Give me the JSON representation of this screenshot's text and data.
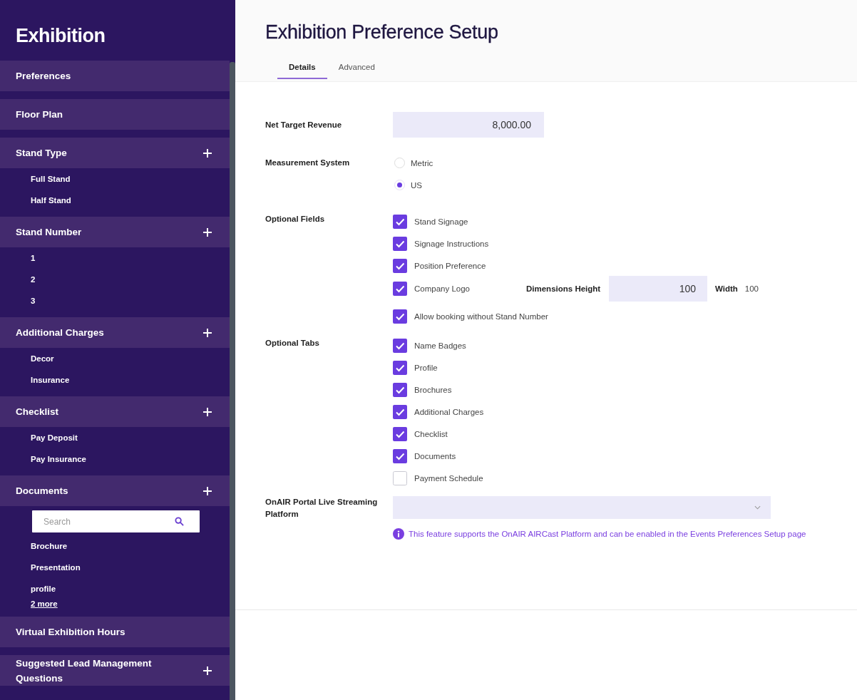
{
  "sidebar": {
    "title": "Exhibition",
    "sections": [
      {
        "label": "Preferences",
        "expandable": false
      },
      {
        "label": "Floor Plan",
        "expandable": false
      },
      {
        "label": "Stand Type",
        "expandable": true,
        "items": [
          {
            "label": "Full Stand"
          },
          {
            "label": "Half Stand"
          }
        ]
      },
      {
        "label": "Stand Number",
        "expandable": true,
        "items": [
          {
            "label": "1"
          },
          {
            "label": "2"
          },
          {
            "label": "3"
          }
        ]
      },
      {
        "label": "Additional Charges",
        "expandable": true,
        "items": [
          {
            "label": "Decor"
          },
          {
            "label": "Insurance"
          }
        ]
      },
      {
        "label": "Checklist",
        "expandable": true,
        "items": [
          {
            "label": "Pay Deposit"
          },
          {
            "label": "Pay Insurance"
          }
        ]
      },
      {
        "label": "Documents",
        "expandable": true,
        "search": {
          "placeholder": "Search"
        },
        "items": [
          {
            "label": "Brochure"
          },
          {
            "label": "Presentation"
          },
          {
            "label": "profile"
          }
        ],
        "more_link": "2 more"
      },
      {
        "label": "Virtual Exhibition Hours",
        "expandable": false
      },
      {
        "label": "Suggested Lead Management Questions",
        "expandable": true
      }
    ]
  },
  "page": {
    "title": "Exhibition Preference Setup",
    "tabs": [
      {
        "label": "Details",
        "selected": true
      },
      {
        "label": "Advanced",
        "selected": false
      }
    ]
  },
  "form": [
    {
      "kind": "text",
      "label": "Net Target Revenue",
      "value": "8,000.00"
    },
    {
      "kind": "radio",
      "label": "Measurement System",
      "options": [
        {
          "label": "Metric",
          "selected": false
        },
        {
          "label": "US",
          "selected": true
        }
      ]
    },
    {
      "kind": "checkbox",
      "label": "Optional Fields",
      "options": [
        {
          "label": "Stand Signage",
          "checked": true
        },
        {
          "label": "Signage Instructions",
          "checked": true
        },
        {
          "label": "Position Preference",
          "checked": true
        },
        {
          "label": "Company Logo",
          "checked": true,
          "dimensions": {
            "height_label": "Dimensions Height",
            "height_value": "100",
            "width_label": "Width",
            "width_value": "100"
          }
        },
        {
          "label": "Allow booking without Stand Number",
          "checked": true
        }
      ]
    },
    {
      "kind": "checkbox",
      "label": "Optional Tabs",
      "options": [
        {
          "label": "Name Badges",
          "checked": true
        },
        {
          "label": "Profile",
          "checked": true
        },
        {
          "label": "Brochures",
          "checked": true
        },
        {
          "label": "Additional Charges",
          "checked": true
        },
        {
          "label": "Checklist",
          "checked": true
        },
        {
          "label": "Documents",
          "checked": true
        },
        {
          "label": "Payment Schedule",
          "checked": false
        }
      ]
    },
    {
      "kind": "select",
      "label": "OnAIR Portal Live Streaming Platform",
      "note": "This feature supports the OnAIR AIRCast Platform and can be enabled in the Events Preferences Setup page"
    }
  ]
}
